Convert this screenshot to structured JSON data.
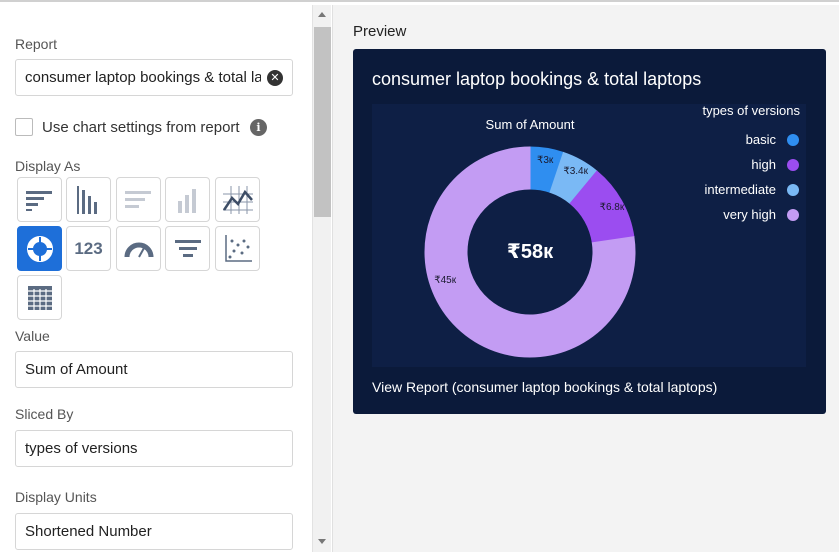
{
  "settings": {
    "report_label": "Report",
    "report_value": "consumer laptop bookings & total la",
    "use_chart_settings_label": "Use chart settings from report",
    "display_as_label": "Display As",
    "value_label": "Value",
    "value_value": "Sum of Amount",
    "sliced_by_label": "Sliced By",
    "sliced_by_value": "types of versions",
    "display_units_label": "Display Units",
    "display_units_value": "Shortened Number",
    "chart_types": [
      {
        "name": "horizontal-bar",
        "selected": false
      },
      {
        "name": "vertical-bar",
        "selected": false
      },
      {
        "name": "stacked-horizontal-bar",
        "selected": false
      },
      {
        "name": "stacked-vertical-bar",
        "selected": false
      },
      {
        "name": "line",
        "selected": false
      },
      {
        "name": "donut",
        "selected": true
      },
      {
        "name": "metric",
        "selected": false,
        "text": "123"
      },
      {
        "name": "gauge",
        "selected": false
      },
      {
        "name": "funnel",
        "selected": false
      },
      {
        "name": "scatter",
        "selected": false
      },
      {
        "name": "table",
        "selected": false
      }
    ]
  },
  "preview": {
    "label": "Preview",
    "title": "consumer laptop bookings & total laptops",
    "view_report": "View Report (consumer laptop bookings & total laptops)"
  },
  "colors": {
    "accent": "#1e6fd9",
    "card_bg": "#0b1a3a",
    "basic": "#2f8ef0",
    "high": "#9b4df0",
    "intermediate": "#7ab9f5",
    "very_high": "#c39cf3"
  },
  "chart_data": {
    "type": "pie",
    "subtype": "donut",
    "title": "Sum of Amount",
    "center_label": "₹58к",
    "legend_title": "types of versions",
    "legend_position": "top-right",
    "slices": [
      {
        "name": "basic",
        "value": 3000,
        "label": "₹3к",
        "color": "#2f8ef0"
      },
      {
        "name": "intermediate",
        "value": 3400,
        "label": "₹3.4к",
        "color": "#7ab9f5"
      },
      {
        "name": "high",
        "value": 6800,
        "label": "₹6.8к",
        "color": "#9b4df0"
      },
      {
        "name": "very high",
        "value": 45000,
        "label": "₹45к",
        "color": "#c39cf3"
      }
    ],
    "legend": [
      {
        "name": "basic",
        "color": "#2f8ef0"
      },
      {
        "name": "high",
        "color": "#9b4df0"
      },
      {
        "name": "intermediate",
        "color": "#7ab9f5"
      },
      {
        "name": "very high",
        "color": "#c39cf3"
      }
    ]
  }
}
